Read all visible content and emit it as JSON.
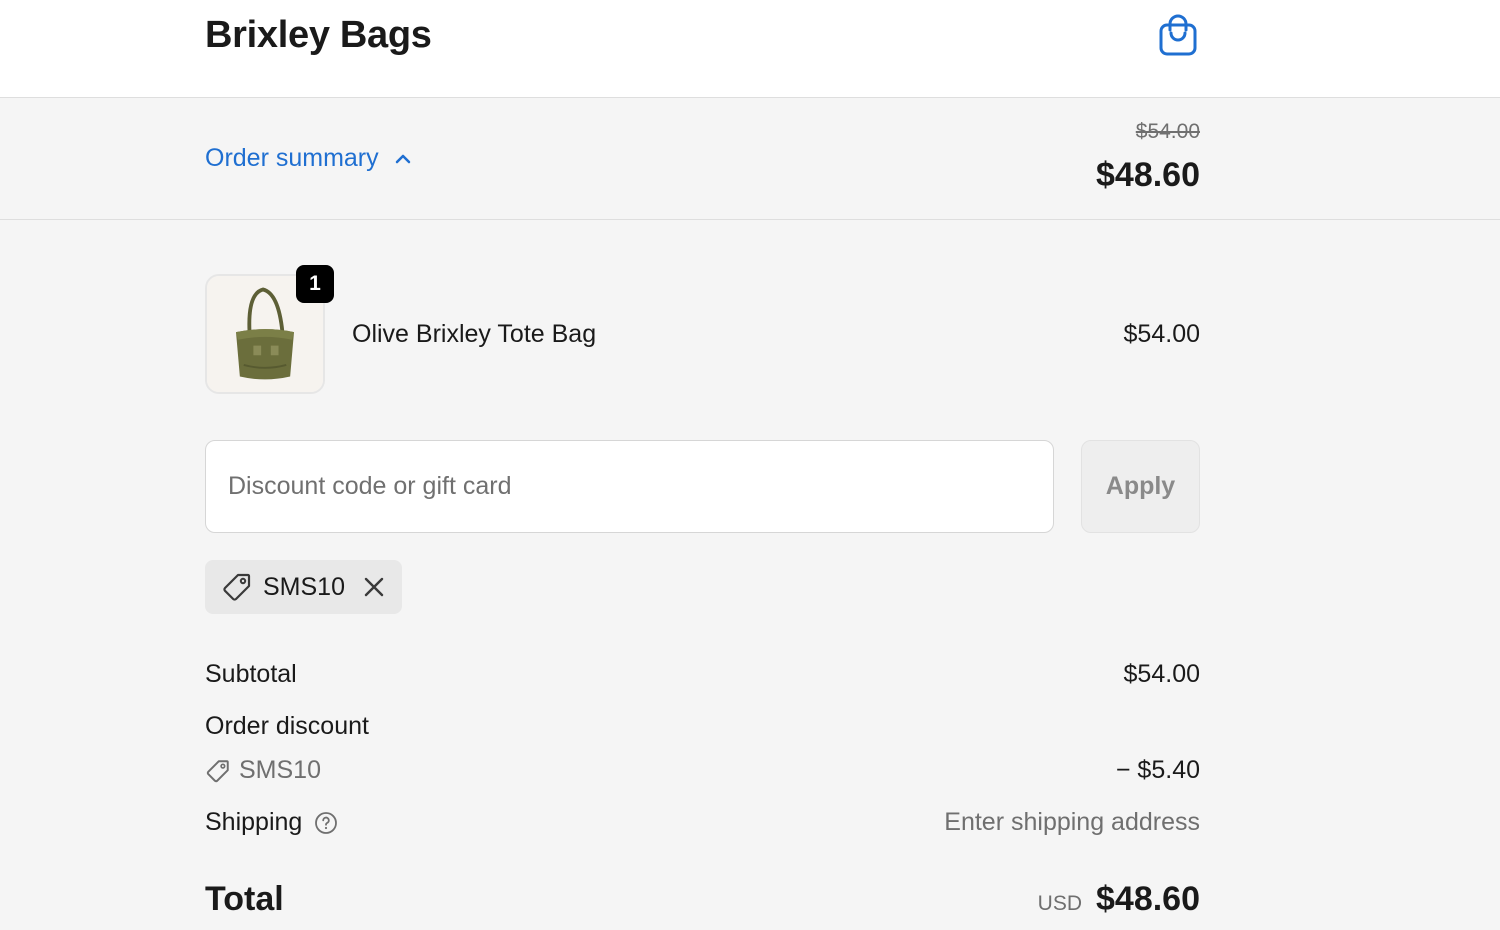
{
  "header": {
    "brand": "Brixley Bags",
    "cart_icon": "shopping-bag-icon",
    "accent_color": "#1f6fd1"
  },
  "summary_bar": {
    "toggle_label": "Order summary",
    "toggle_icon": "chevron-up-icon",
    "original_total": "$54.00",
    "discounted_total": "$48.60"
  },
  "line_items": [
    {
      "name": "Olive Brixley Tote Bag",
      "quantity": "1",
      "price": "$54.00",
      "thumbnail_icon": "olive-tote-bag-image"
    }
  ],
  "discount": {
    "placeholder": "Discount code or gift card",
    "value": "",
    "apply_label": "Apply",
    "applied_code": "SMS10",
    "tag_icon": "tag-icon",
    "remove_icon": "close-icon"
  },
  "totals": {
    "subtotal_label": "Subtotal",
    "subtotal_value": "$54.00",
    "order_discount_label": "Order discount",
    "order_discount_code": "SMS10",
    "order_discount_value": "− $5.40",
    "shipping_label": "Shipping",
    "shipping_help_icon": "question-circle-icon",
    "shipping_value": "Enter shipping address",
    "total_label": "Total",
    "currency": "USD",
    "total_value": "$48.60"
  }
}
